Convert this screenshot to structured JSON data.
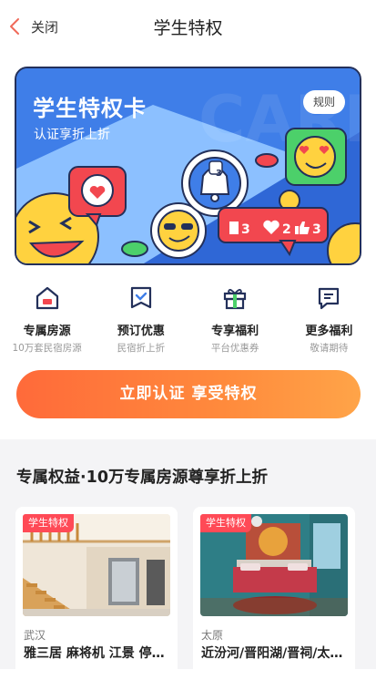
{
  "nav": {
    "back_label": "关闭",
    "title": "学生特权"
  },
  "hero": {
    "title": "学生特权卡",
    "subtitle": "认证享折上折",
    "rules_label": "规则",
    "badge": {
      "bell_count": "3",
      "likes": "3",
      "hearts": "2",
      "thumbs": "3"
    },
    "colors": {
      "blue": "#3f7ee8",
      "light_blue": "#8cc0ff",
      "yellow": "#ffd23f",
      "red": "#f2474f",
      "green": "#4cd06a"
    }
  },
  "features": [
    {
      "icon": "house-icon",
      "title": "专属房源",
      "sub": "10万套民宿房源"
    },
    {
      "icon": "ticket-icon",
      "title": "预订优惠",
      "sub": "民宿折上折"
    },
    {
      "icon": "gift-icon",
      "title": "专享福利",
      "sub": "平台优惠券"
    },
    {
      "icon": "message-icon",
      "title": "更多福利",
      "sub": "敬请期待"
    }
  ],
  "cta": {
    "label": "立即认证 享受特权",
    "color": "#ff7a3c"
  },
  "section": {
    "title": "专属权益·10万专属房源尊享折上折",
    "cards": [
      {
        "tag": "学生特权",
        "city": "武汉",
        "name": "雅三居 麻将机 江景 停车场 地铁"
      },
      {
        "tag": "学生特权",
        "city": "太原",
        "name": "近汾河/晋阳湖/晋祠/太原南站"
      }
    ]
  }
}
